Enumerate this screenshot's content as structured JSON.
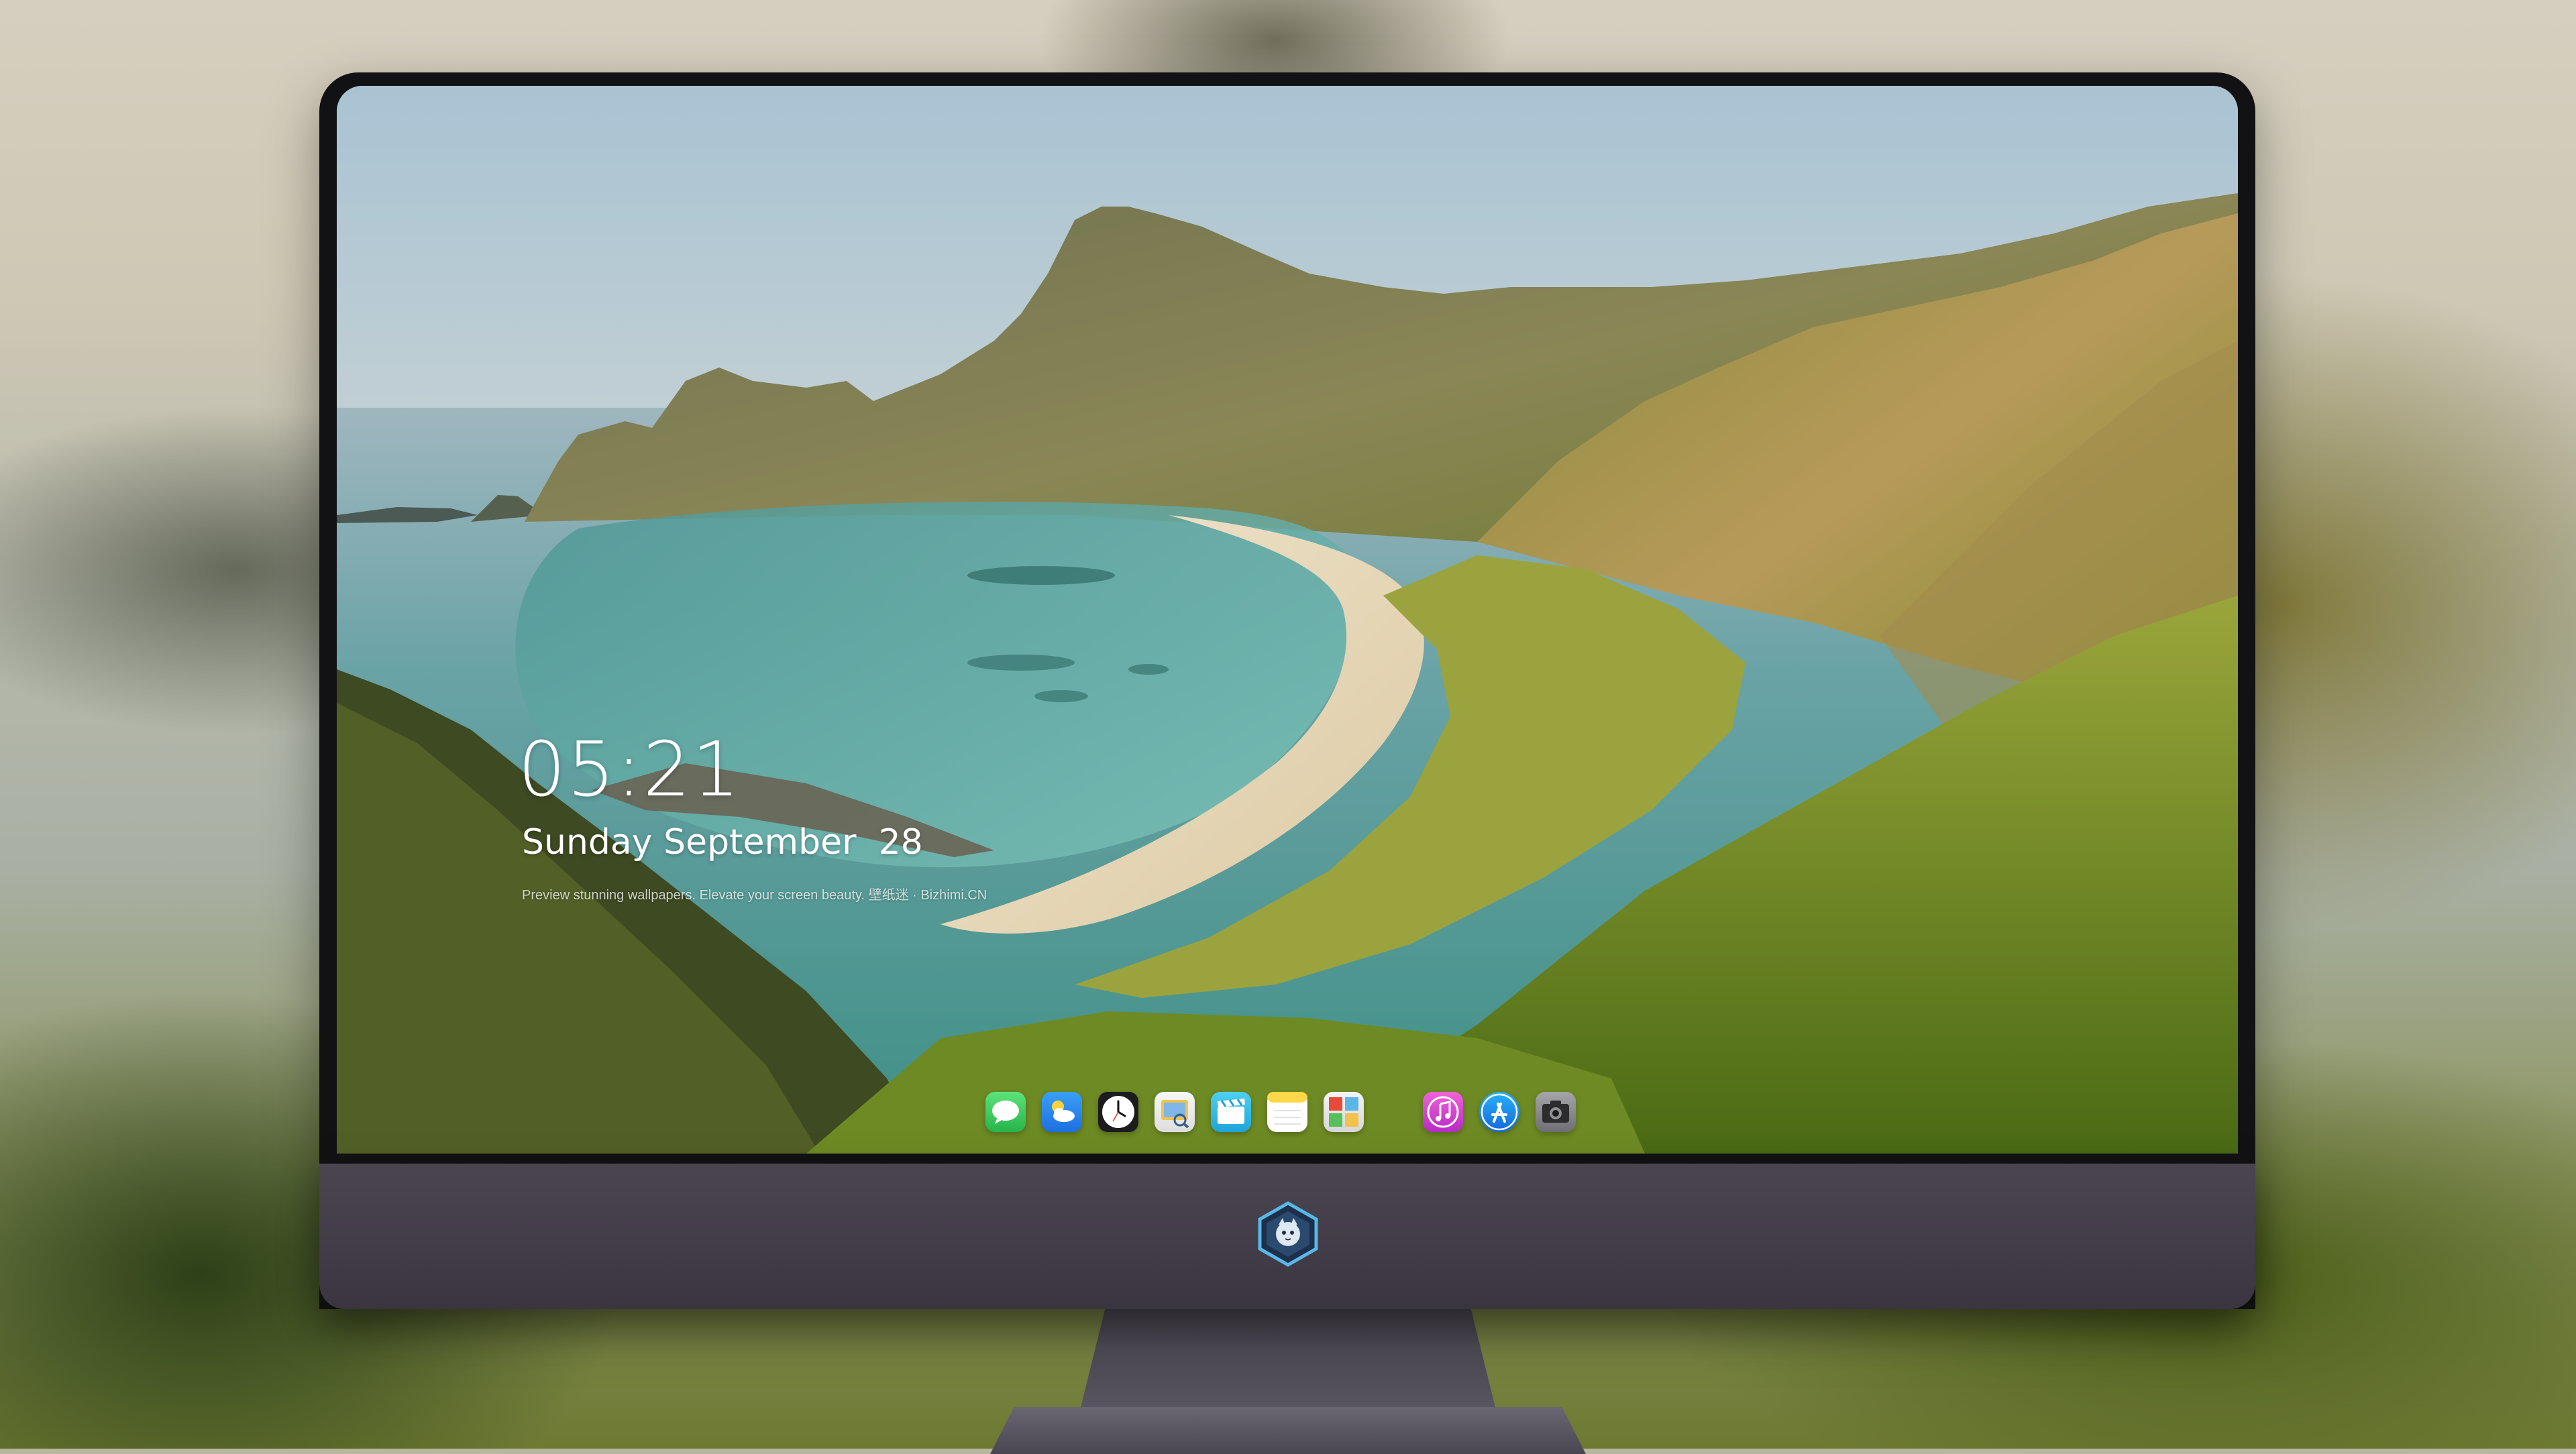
{
  "lockscreen": {
    "time": "05:21",
    "date": "Sunday September  28",
    "tagline": "Preview stunning wallpapers. Elevate your screen beauty. 壁纸迷 · Bizhimi.CN"
  },
  "dock": {
    "items": [
      {
        "name": "Messages",
        "icon": "messages-icon",
        "color": "#34c759"
      },
      {
        "name": "Weather",
        "icon": "weather-icon",
        "color": "#2f8cf0"
      },
      {
        "name": "Clock",
        "icon": "clock-icon",
        "color": "#1c1c1e"
      },
      {
        "name": "Preview",
        "icon": "preview-icon",
        "color": "#f2c34a"
      },
      {
        "name": "Clips",
        "icon": "clips-icon",
        "color": "#38c0e8"
      },
      {
        "name": "Notes",
        "icon": "notes-icon",
        "color": "#ffd84a"
      },
      {
        "name": "Photo Booth",
        "icon": "photobooth-icon",
        "color": "#5bb6e8"
      },
      {
        "name": "iTunes",
        "icon": "itunes-icon",
        "color": "#e044c8"
      },
      {
        "name": "App Store",
        "icon": "appstore-icon",
        "color": "#1a8df2"
      },
      {
        "name": "Camera",
        "icon": "camera-icon",
        "color": "#8e8e93"
      }
    ]
  },
  "colors": {
    "bezel": "#121214",
    "chin": "#433e49",
    "sky": "#c9d8df",
    "sea": "#5fa7a4"
  }
}
